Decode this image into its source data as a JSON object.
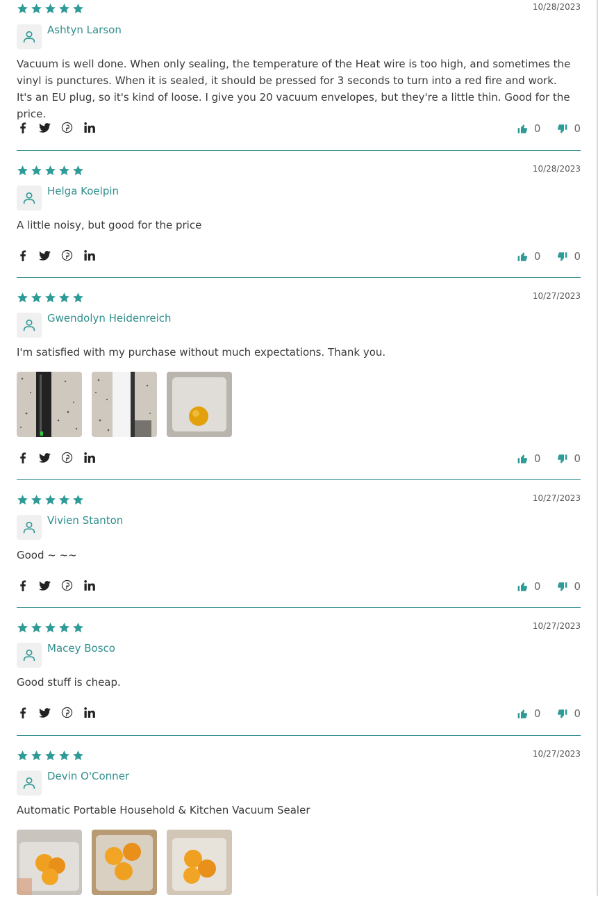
{
  "colors": {
    "accent": "#2f9b97",
    "divider": "#2e8b8b"
  },
  "social_icons": [
    "facebook-icon",
    "twitter-icon",
    "pinterest-icon",
    "linkedin-icon"
  ],
  "reviews": [
    {
      "rating": 5,
      "date": "10/28/2023",
      "author": "Ashtyn Larson",
      "text": "Vacuum is well done. When only sealing, the temperature of the Heat wire is too high, and sometimes the vinyl is punctures. When it is sealed, it should be pressed for 3 seconds to turn into a red fire and work. It's an EU plug, so it's kind of loose. I give you 20 vacuum envelopes, but they're a little thin. Good for the price.",
      "likes": "0",
      "dislikes": "0",
      "photos": []
    },
    {
      "rating": 5,
      "date": "10/28/2023",
      "author": "Helga Koelpin",
      "text": "A little noisy, but good for the price",
      "likes": "0",
      "dislikes": "0",
      "photos": []
    },
    {
      "rating": 5,
      "date": "10/27/2023",
      "author": "Gwendolyn Heidenreich",
      "text": "I'm satisfied with my purchase without much expectations. Thank you.",
      "likes": "0",
      "dislikes": "0",
      "photos": [
        "sealer-on-counter-photo",
        "sealer-side-photo",
        "sealed-orange-photo"
      ]
    },
    {
      "rating": 5,
      "date": "10/27/2023",
      "author": "Vivien Stanton",
      "text": "Good ~ ~~",
      "likes": "0",
      "dislikes": "0",
      "photos": []
    },
    {
      "rating": 5,
      "date": "10/27/2023",
      "author": "Macey Bosco",
      "text": "Good stuff is cheap.",
      "likes": "0",
      "dislikes": "0",
      "photos": []
    },
    {
      "rating": 5,
      "date": "10/27/2023",
      "author": "Devin O'Conner",
      "text": "Automatic Portable Household & Kitchen Vacuum Sealer",
      "likes": "0",
      "dislikes": "0",
      "photos": [
        "sealed-oranges-photo-1",
        "sealed-oranges-photo-2",
        "sealed-oranges-photo-3"
      ]
    }
  ]
}
